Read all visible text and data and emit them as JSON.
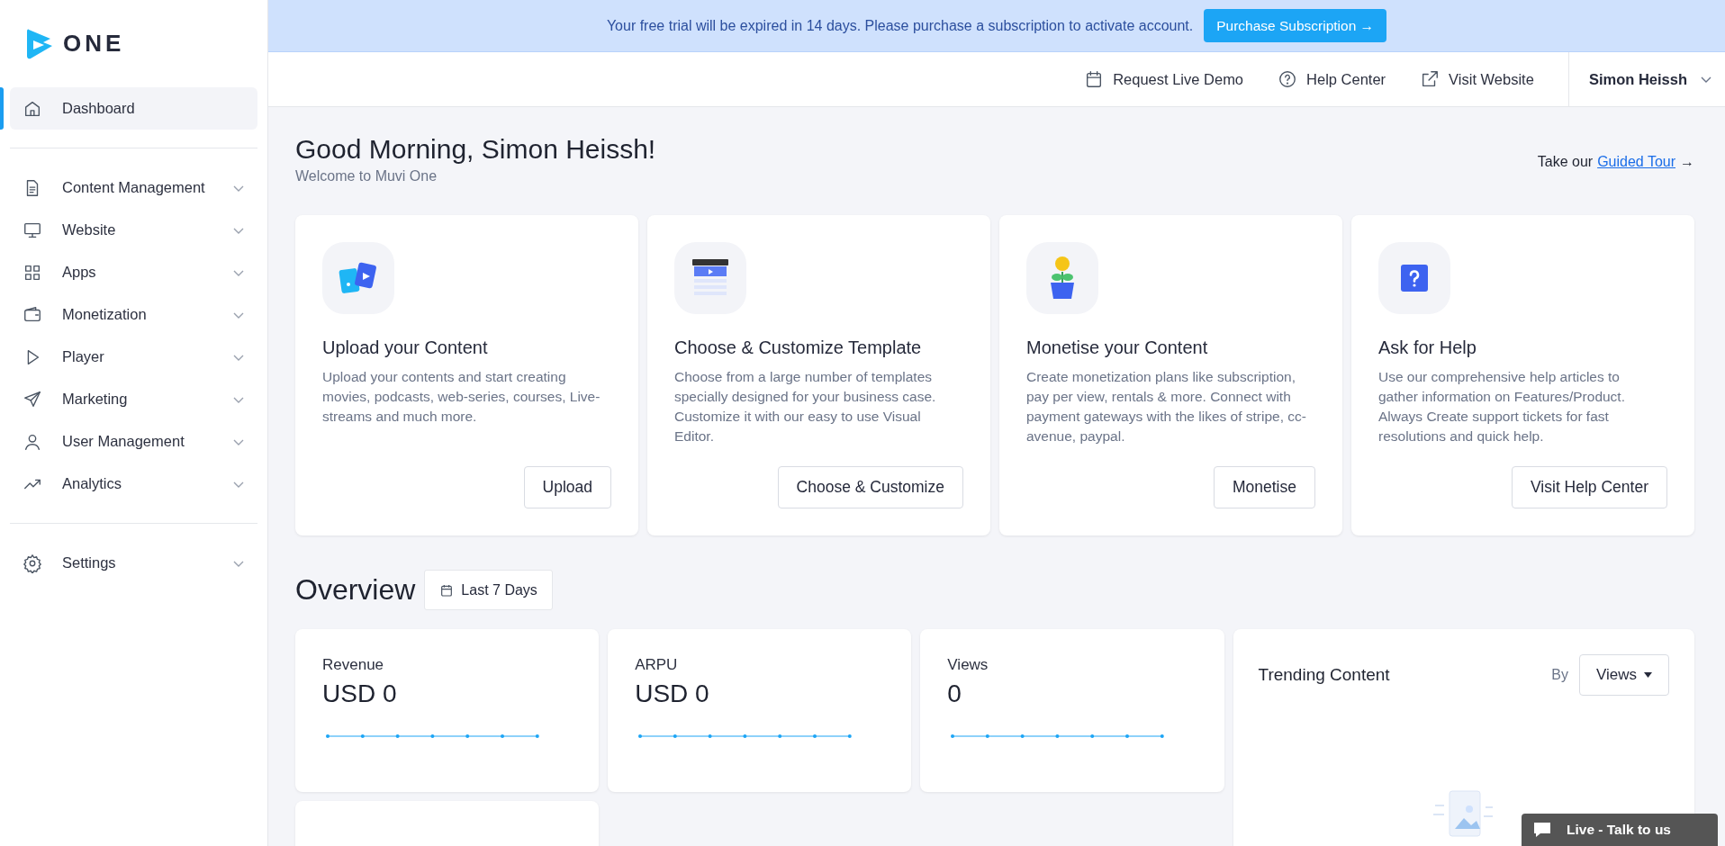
{
  "logo": {
    "text": "ONE"
  },
  "sidebar": {
    "groups": [
      [
        {
          "label": "Dashboard",
          "kind": "home",
          "selected": true,
          "expandable": false
        }
      ],
      [
        {
          "label": "Content Management",
          "kind": "document",
          "selected": false,
          "expandable": true
        },
        {
          "label": "Website",
          "kind": "monitor",
          "selected": false,
          "expandable": true
        },
        {
          "label": "Apps",
          "kind": "grid",
          "selected": false,
          "expandable": true
        },
        {
          "label": "Monetization",
          "kind": "wallet",
          "selected": false,
          "expandable": true
        },
        {
          "label": "Player",
          "kind": "play",
          "selected": false,
          "expandable": true
        },
        {
          "label": "Marketing",
          "kind": "send",
          "selected": false,
          "expandable": true
        },
        {
          "label": "User Management",
          "kind": "user",
          "selected": false,
          "expandable": true
        },
        {
          "label": "Analytics",
          "kind": "trend",
          "selected": false,
          "expandable": true
        }
      ],
      [
        {
          "label": "Settings",
          "kind": "gear",
          "selected": false,
          "expandable": true
        }
      ]
    ]
  },
  "banner": {
    "message": "Your free trial will be expired in 14 days. Please purchase a subscription to activate account.",
    "button": "Purchase Subscription →"
  },
  "header": {
    "links": [
      {
        "label": "Request Live Demo",
        "kind": "calendar"
      },
      {
        "label": "Help Center",
        "kind": "help"
      },
      {
        "label": "Visit Website",
        "kind": "external"
      }
    ],
    "user": "Simon Heissh"
  },
  "greeting": {
    "title": "Good Morning, Simon Heissh!",
    "subtitle": "Welcome to Muvi One",
    "tour_prefix": "Take our",
    "tour_link": "Guided Tour",
    "tour_arrow": "→"
  },
  "cards": [
    {
      "kind": "upload",
      "title": "Upload your Content",
      "description": "Upload your contents and start creating movies, podcasts, web-series, courses, Live-streams and much more.",
      "button": "Upload"
    },
    {
      "kind": "template",
      "title": "Choose & Customize Template",
      "description": "Choose from a large number of templates specially designed for your business case. Customize it with our easy to use Visual Editor.",
      "button": "Choose & Customize"
    },
    {
      "kind": "monetise",
      "title": "Monetise your Content",
      "description": "Create monetization plans like subscription, pay per view, rentals & more. Connect with payment gateways with the likes of stripe, cc-avenue, paypal.",
      "button": "Monetise"
    },
    {
      "kind": "help",
      "title": "Ask for Help",
      "description": "Use our comprehensive help articles to gather information on Features/Product. Always Create support tickets for fast resolutions and quick help.",
      "button": "Visit Help Center"
    }
  ],
  "overview": {
    "title": "Overview",
    "range": "Last 7 Days",
    "stats": [
      {
        "label": "Revenue",
        "value": "USD 0"
      },
      {
        "label": "ARPU",
        "value": "USD 0"
      },
      {
        "label": "Views",
        "value": "0"
      }
    ],
    "trending": {
      "title": "Trending Content",
      "by_label": "By",
      "sort": "Views"
    }
  },
  "chat": {
    "label": "Live - Talk to us"
  }
}
